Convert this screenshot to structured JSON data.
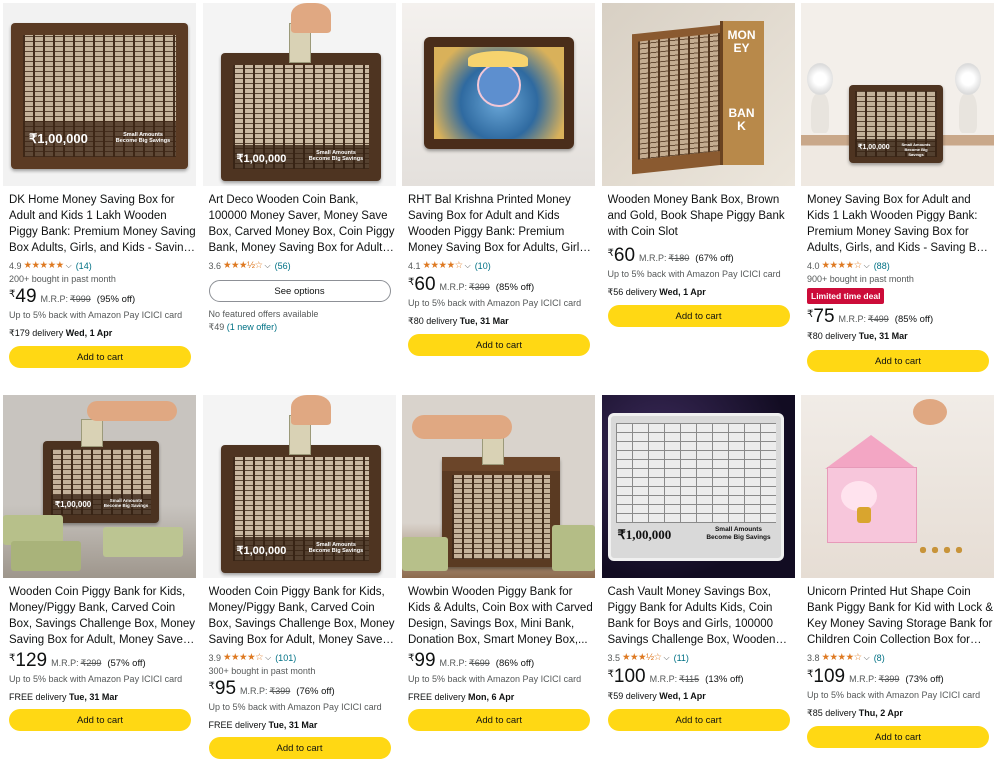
{
  "products": [
    {
      "title": "DK Home Money Saving Box for Adult and Kids 1 Lakh Wooden Piggy Bank: Premium Money Saving Box Adults, Girls, and Kids - Saving Box...",
      "image": {
        "amount": "₹1,00,000",
        "tagline": "Small Amounts Become Big Savings"
      },
      "rating": "4.9",
      "stars": "★★★★★",
      "reviews": "(14)",
      "bought": "200+ bought in past month",
      "currency": "₹",
      "price": "49",
      "mrp_label": "M.R.P:",
      "mrp": "₹999",
      "discount": "(95% off)",
      "cashback": "Up to 5% back with Amazon Pay ICICI card",
      "delivery_prefix": "₹179 delivery",
      "delivery_date": "Wed, 1 Apr",
      "button": "Add to cart"
    },
    {
      "title": "Art Deco Wooden Coin Bank, 100000 Money Saver, Money Save Box, Carved Money Box, Coin Piggy Bank, Money Saving Box for Adult, Savin...",
      "image": {
        "amount": "₹1,00,000",
        "tagline": "Small Amounts Become Big Savings"
      },
      "rating": "3.6",
      "stars": "★★★½☆",
      "reviews": "(56)",
      "button": "See options",
      "no_offer": "No featured offers available",
      "used_price": "₹49",
      "used_link": "(1 new offer)"
    },
    {
      "title": "RHT Bal Krishna Printed Money Saving Box for Adult and Kids Wooden Piggy Bank: Premium Money Saving Box for Adults, Girls, and Ki...",
      "rating": "4.1",
      "stars": "★★★★☆",
      "reviews": "(10)",
      "currency": "₹",
      "price": "60",
      "mrp_label": "M.R.P:",
      "mrp": "₹399",
      "discount": "(85% off)",
      "cashback": "Up to 5% back with Amazon Pay ICICI card",
      "delivery_prefix": "₹80 delivery",
      "delivery_date": "Tue, 31 Mar",
      "button": "Add to cart"
    },
    {
      "title": "Wooden Money Bank Box, Brown and Gold, Book Shape Piggy Bank with Coin Slot",
      "image": {
        "spine_top": "MONEY",
        "spine_bottom": "BANK"
      },
      "currency": "₹",
      "price": "60",
      "mrp_label": "M.R.P:",
      "mrp": "₹180",
      "discount": "(67% off)",
      "cashback": "Up to 5% back with Amazon Pay ICICI card",
      "delivery_prefix": "₹56 delivery",
      "delivery_date": "Wed, 1 Apr",
      "button": "Add to cart"
    },
    {
      "title": "Money Saving Box for Adult and Kids 1 Lakh Wooden Piggy Bank: Premium Money Saving Box for Adults, Girls, and Kids - Saving Box for Women,...",
      "image": {
        "amount": "₹1,00,000",
        "tagline": "Small Amounts Become Big Savings"
      },
      "rating": "4.0",
      "stars": "★★★★☆",
      "reviews": "(88)",
      "bought": "900+ bought in past month",
      "deal": "Limited time deal",
      "currency": "₹",
      "price": "75",
      "mrp_label": "M.R.P:",
      "mrp": "₹499",
      "discount": "(85% off)",
      "delivery_prefix": "₹80 delivery",
      "delivery_date": "Tue, 31 Mar",
      "button": "Add to cart"
    },
    {
      "title": "Wooden Coin Piggy Bank for Kids, Money/Piggy Bank, Carved Coin Box, Savings Challenge Box, Money Saving Box for Adult, Money Save Box,...",
      "image": {
        "amount": "₹1,00,000",
        "tagline": "Small Amounts Become Big Savings"
      },
      "currency": "₹",
      "price": "129",
      "mrp_label": "M.R.P:",
      "mrp": "₹299",
      "discount": "(57% off)",
      "cashback": "Up to 5% back with Amazon Pay ICICI card",
      "delivery_prefix": "FREE delivery",
      "delivery_date": "Tue, 31 Mar",
      "button": "Add to cart"
    },
    {
      "title": "Wooden Coin Piggy Bank for Kids, Money/Piggy Bank, Carved Coin Box, Savings Challenge Box, Money Saving Box for Adult, Money Save Box,...",
      "image": {
        "amount": "₹1,00,000",
        "tagline": "Small Amounts Become Big Savings"
      },
      "rating": "3.9",
      "stars": "★★★★☆",
      "reviews": "(101)",
      "bought": "300+ bought in past month",
      "currency": "₹",
      "price": "95",
      "mrp_label": "M.R.P:",
      "mrp": "₹399",
      "discount": "(76% off)",
      "cashback": "Up to 5% back with Amazon Pay ICICI card",
      "delivery_prefix": "FREE delivery",
      "delivery_date": "Tue, 31 Mar",
      "button": "Add to cart"
    },
    {
      "title": "Wowbin Wooden Piggy Bank for Kids & Adults, Coin Box with Carved Design, Savings Box, Mini Bank, Donation Box, Smart Money Box,...",
      "currency": "₹",
      "price": "99",
      "mrp_label": "M.R.P:",
      "mrp": "₹699",
      "discount": "(86% off)",
      "cashback": "Up to 5% back with Amazon Pay ICICI card",
      "delivery_prefix": "FREE delivery",
      "delivery_date": "Mon, 6 Apr",
      "button": "Add to cart"
    },
    {
      "title": "Cash Vault Money Savings Box, Piggy Bank for Adults Kids, Coin Bank for Boys and Girls, 100000 Savings Challenge Box, Wooden Cash Savin...",
      "image": {
        "amount": "₹1,00,000",
        "tagline": "Small Amounts Become Big Savings"
      },
      "rating": "3.5",
      "stars": "★★★½☆",
      "reviews": "(11)",
      "currency": "₹",
      "price": "100",
      "mrp_label": "M.R.P:",
      "mrp": "₹115",
      "discount": "(13% off)",
      "delivery_prefix": "₹59 delivery",
      "delivery_date": "Wed, 1 Apr",
      "button": "Add to cart"
    },
    {
      "title": "Unicorn Printed Hut Shape Coin Bank Piggy Bank for Kid with Lock & Key Money Saving Storage Bank for Children Coin Collection Box for Gir...",
      "rating": "3.8",
      "stars": "★★★★☆",
      "reviews": "(8)",
      "currency": "₹",
      "price": "109",
      "mrp_label": "M.R.P:",
      "mrp": "₹399",
      "discount": "(73% off)",
      "cashback": "Up to 5% back with Amazon Pay ICICI card",
      "delivery_prefix": "₹85 delivery",
      "delivery_date": "Thu, 2 Apr",
      "button": "Add to cart"
    }
  ]
}
